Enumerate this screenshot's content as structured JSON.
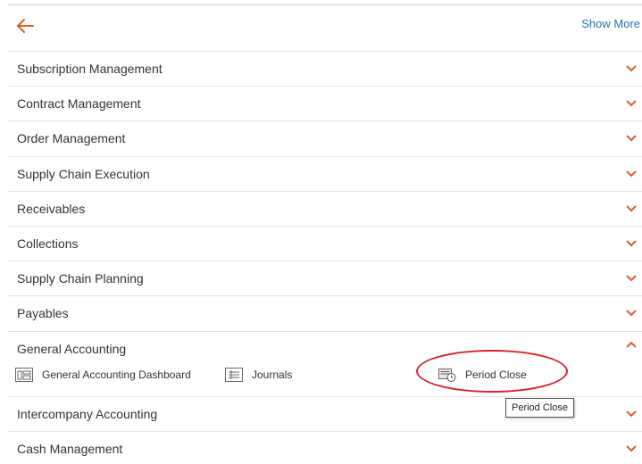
{
  "header": {
    "back_icon": "arrow-left-icon",
    "show_more_label": "Show More"
  },
  "colors": {
    "accent": "#d9602b",
    "link": "#2a6fb6",
    "highlight": "#d9202b"
  },
  "sections": [
    {
      "label": "Subscription Management",
      "expanded": false
    },
    {
      "label": "Contract Management",
      "expanded": false
    },
    {
      "label": "Order Management",
      "expanded": false
    },
    {
      "label": "Supply Chain Execution",
      "expanded": false
    },
    {
      "label": "Receivables",
      "expanded": false
    },
    {
      "label": "Collections",
      "expanded": false
    },
    {
      "label": "Supply Chain Planning",
      "expanded": false
    },
    {
      "label": "Payables",
      "expanded": false
    },
    {
      "label": "General Accounting",
      "expanded": true,
      "items": [
        {
          "label": "General Accounting Dashboard",
          "icon": "dashboard-icon"
        },
        {
          "label": "Journals",
          "icon": "journals-icon"
        },
        {
          "label": "Period Close",
          "icon": "period-close-icon"
        }
      ]
    },
    {
      "label": "Intercompany Accounting",
      "expanded": false
    },
    {
      "label": "Cash Management",
      "expanded": false
    }
  ],
  "tooltip": {
    "text": "Period Close"
  }
}
